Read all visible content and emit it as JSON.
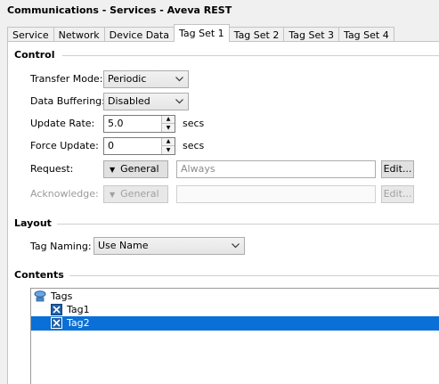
{
  "window": {
    "title": "Communications - Services - Aveva REST"
  },
  "tabs": [
    {
      "label": "Service"
    },
    {
      "label": "Network"
    },
    {
      "label": "Device Data"
    },
    {
      "label": "Tag Set 1"
    },
    {
      "label": "Tag Set 2"
    },
    {
      "label": "Tag Set 3"
    },
    {
      "label": "Tag Set 4"
    }
  ],
  "active_tab": "Tag Set 1",
  "control": {
    "heading": "Control",
    "transfer_mode": {
      "label": "Transfer Mode:",
      "value": "Periodic"
    },
    "data_buffering": {
      "label": "Data Buffering:",
      "value": "Disabled"
    },
    "update_rate": {
      "label": "Update Rate:",
      "value": "5.0",
      "unit": "secs"
    },
    "force_update": {
      "label": "Force Update:",
      "value": "0",
      "unit": "secs"
    },
    "request": {
      "label": "Request:",
      "type_button": "General",
      "value": "Always",
      "edit_button": "Edit..."
    },
    "acknowledge": {
      "label": "Acknowledge:",
      "type_button": "General",
      "value": "",
      "edit_button": "Edit..."
    }
  },
  "layout": {
    "heading": "Layout",
    "tag_naming": {
      "label": "Tag Naming:",
      "value": "Use Name"
    }
  },
  "contents": {
    "heading": "Contents",
    "root": "Tags",
    "items": [
      "Tag1",
      "Tag2"
    ],
    "selected": "Tag2"
  },
  "colors": {
    "selection": "#0a6fd6",
    "tag_icon": "#1f5fa8"
  }
}
